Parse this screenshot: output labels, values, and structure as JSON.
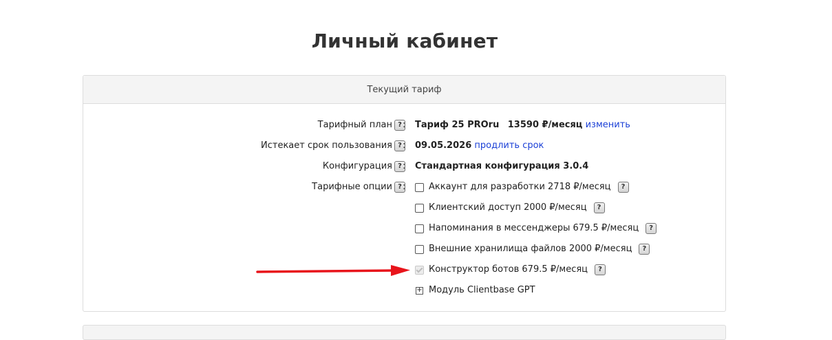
{
  "page": {
    "title": "Личный кабинет"
  },
  "panel": {
    "header": "Текущий тариф",
    "rows": {
      "plan": {
        "label": "Тарифный план",
        "name": "Тариф 25 PROru",
        "price": "13590 ₽/месяц",
        "link": "изменить"
      },
      "expires": {
        "label": "Истекает срок пользования",
        "date": "09.05.2026",
        "link": "продлить срок"
      },
      "config": {
        "label": "Конфигурация",
        "value": "Стандартная конфигурация 3.0.4"
      },
      "options": {
        "label": "Тарифные опции"
      }
    },
    "options": [
      {
        "text": "Аккаунт для разработки  2718 ₽/месяц",
        "checked": false,
        "disabled": false
      },
      {
        "text": "Клиентский доступ  2000 ₽/месяц",
        "checked": false,
        "disabled": false
      },
      {
        "text": "Напоминания в мессенджеры  679.5 ₽/месяц",
        "checked": false,
        "disabled": false
      },
      {
        "text": "Внешние хранилища файлов  2000 ₽/месяц",
        "checked": false,
        "disabled": false
      },
      {
        "text": "Конструктор ботов  679.5 ₽/месяц",
        "checked": true,
        "disabled": true
      }
    ],
    "module": {
      "text": "Модуль Clientbase GPT",
      "expander": "+"
    },
    "help_glyph": "?",
    "colon": ":"
  },
  "colors": {
    "link": "#1a3fd6",
    "arrow": "#e8141b",
    "header_bg": "#f4f4f4"
  },
  "icons": {
    "help": "help-icon",
    "arrow": "red-arrow-annotation",
    "expand": "plus-box-icon"
  }
}
